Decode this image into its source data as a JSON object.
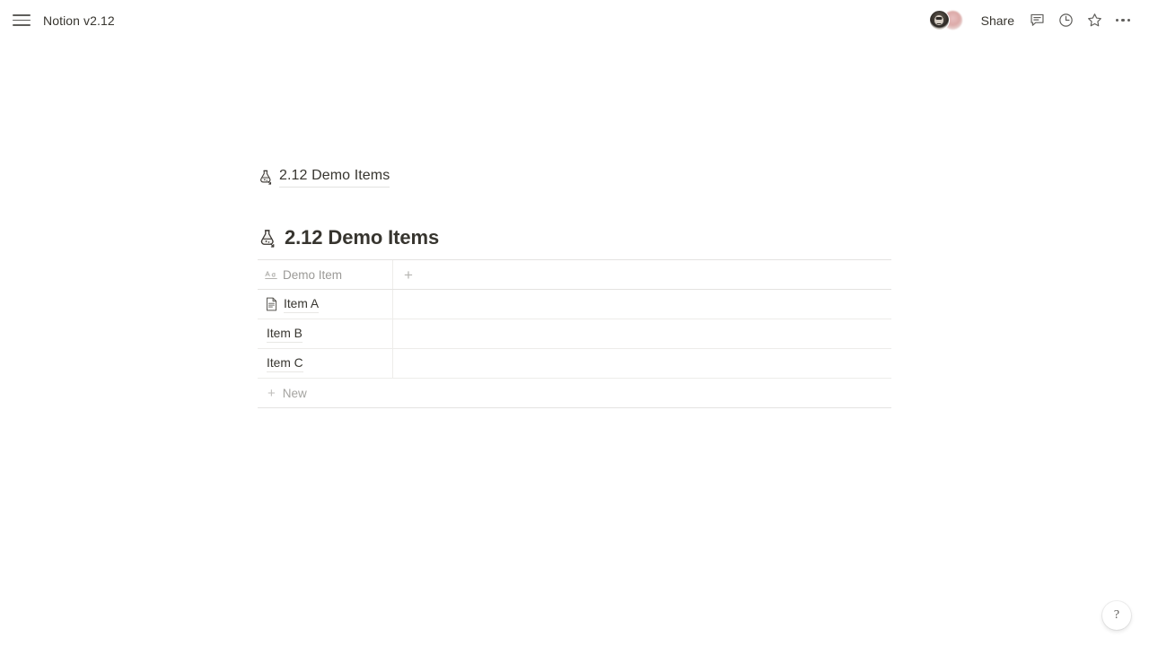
{
  "topbar": {
    "menu_icon": "hamburger-menu-icon",
    "app_title": "Notion v2.12",
    "share_label": "Share",
    "icons": [
      {
        "name": "comment-icon",
        "label": "Comments"
      },
      {
        "name": "clock-icon",
        "label": "Updates"
      },
      {
        "name": "star-icon",
        "label": "Favorite"
      },
      {
        "name": "more-options-icon",
        "label": "More"
      }
    ],
    "avatars": [
      {
        "name": "avatar-user-1"
      },
      {
        "name": "avatar-user-2"
      }
    ]
  },
  "breadcrumb": {
    "icon": "alembic-flask-icon",
    "label": "2.12 Demo Items"
  },
  "page": {
    "icon": "alembic-flask-icon",
    "title": "2.12 Demo Items"
  },
  "table": {
    "columns": [
      {
        "icon": "title-text-icon",
        "icon_label": "Aa",
        "label": "Demo Item"
      }
    ],
    "add_column_label": "+",
    "rows": [
      {
        "icon": "page-document-icon",
        "title": "Item A"
      },
      {
        "icon": null,
        "title": "Item B"
      },
      {
        "icon": null,
        "title": "Item C"
      }
    ],
    "new_row": {
      "plus": "+",
      "label": "New"
    }
  },
  "help": {
    "icon": "question-mark-icon",
    "label": "?"
  },
  "colors": {
    "text": "#37352f",
    "muted": "#9b9a97",
    "border": "#edecea",
    "background": "#ffffff"
  }
}
